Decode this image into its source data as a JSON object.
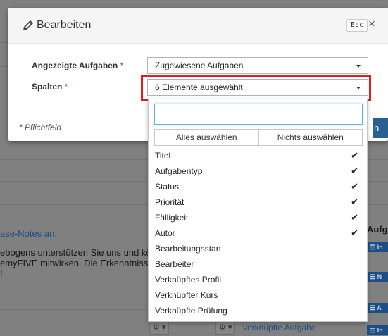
{
  "modal": {
    "title": "Bearbeiten",
    "esc_label": "Esc",
    "close_glyph": "×",
    "fields": [
      {
        "label": "Angezeigte Aufgaben",
        "required_mark": "*",
        "value": "Zugewiesene Aufgaben"
      },
      {
        "label": "Spalten",
        "required_mark": "*",
        "value": "6 Elemente ausgewählt"
      }
    ],
    "footnote": "* Pflichtfeld",
    "primary_button_label": "n"
  },
  "dropdown": {
    "search_value": "",
    "select_all_label": "Alles auswählen",
    "select_none_label": "Nichts auswählen",
    "items": [
      {
        "label": "Titel",
        "checked": true
      },
      {
        "label": "Aufgabentyp",
        "checked": true
      },
      {
        "label": "Status",
        "checked": true
      },
      {
        "label": "Priorität",
        "checked": true
      },
      {
        "label": "Fälligkeit",
        "checked": true
      },
      {
        "label": "Autor",
        "checked": true
      },
      {
        "label": "Bearbeitungsstart",
        "checked": false
      },
      {
        "label": "Bearbeiter",
        "checked": false
      },
      {
        "label": "Verknüpftes Profil",
        "checked": false
      },
      {
        "label": "Verknüpfter Kurs",
        "checked": false
      },
      {
        "label": "Verknüpfte Prüfung",
        "checked": false
      }
    ]
  },
  "background": {
    "text_lines": [
      "ase-Notes an.",
      "ebogens unterstützen Sie uns und kön",
      "emyFIVE mitwirken. Die Erkenntnisse",
      "!"
    ],
    "right_header": "Aufga",
    "badges": [
      "☰ In",
      "☰ N",
      "☰ A",
      "☰ In"
    ],
    "bottom_link": "verknüpfte Aufgabe"
  },
  "colors": {
    "highlight": "#e01e1e",
    "primary": "#286090",
    "overlay": "#808080"
  }
}
